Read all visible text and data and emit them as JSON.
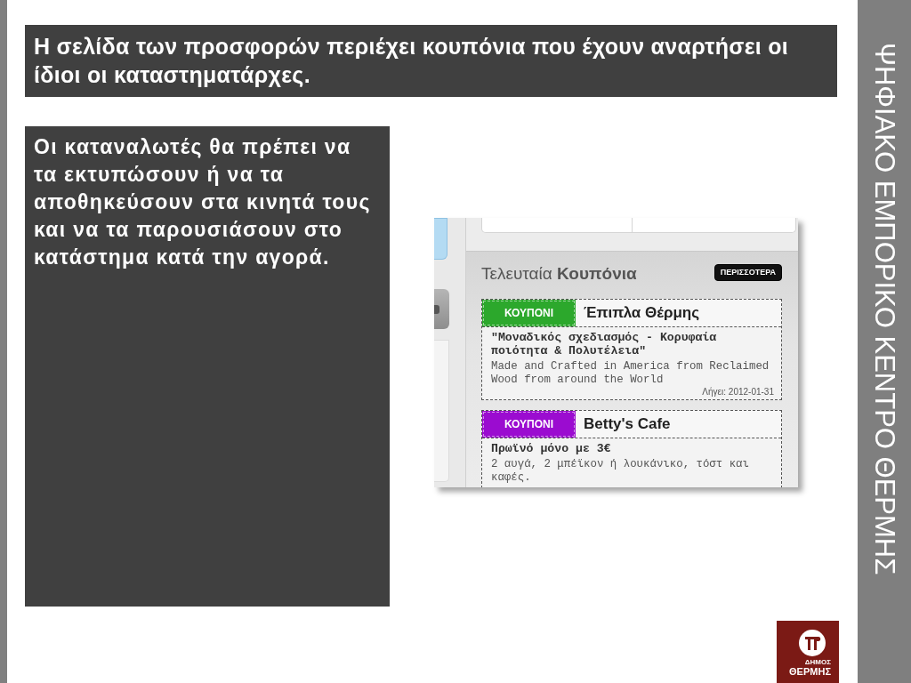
{
  "slide": {
    "title": "Η σελίδα των προσφορών περιέχει κουπόνια που έχουν αναρτήσει οι ίδιοι οι καταστηματάρχες.",
    "body": "Οι καταναλωτές θα πρέπει να τα εκτυπώσουν ή να τα αποθηκεύσουν στα κινητά τους και να τα παρουσιάσουν στο κατάστημα κατά την αγορά.",
    "side_title": "ΨΗΦΙΑΚΟ ΕΜΠΟΡΙΚΟ ΚΕΝΤΡΟ ΘΕΡΜΗΣ"
  },
  "screenshot": {
    "section_title": "Τελευταία **Κουπόνια**",
    "more_button": "ΠΕΡΙΣΣΟΤΕΡΑ",
    "coupons": [
      {
        "tag": "ΚΟΥΠΟΝΙ",
        "color": "#2ca82c",
        "business": "Έπιπλα Θέρμης",
        "headline": "\"Μοναδικός σχεδιασμός - Κορυφαία ποιότητα & Πολυτέλεια\"",
        "description": "Made and Crafted in America from Reclaimed Wood from around the World",
        "expires": "Λήγει: 2012-01-31"
      },
      {
        "tag": "ΚΟΥΠΟΝΙ",
        "color": "#9b0cd0",
        "business": "Betty's Cafe",
        "headline": "Πρωϊνό μόνο με 3€",
        "description": "2 αυγά, 2 μπέϊκον ή λουκάνικο, τόστ και καφές."
      }
    ]
  },
  "logo": {
    "line_1": "ΔΗΜΟΣ",
    "line_2": "ΘΕΡΜΗΣ"
  }
}
